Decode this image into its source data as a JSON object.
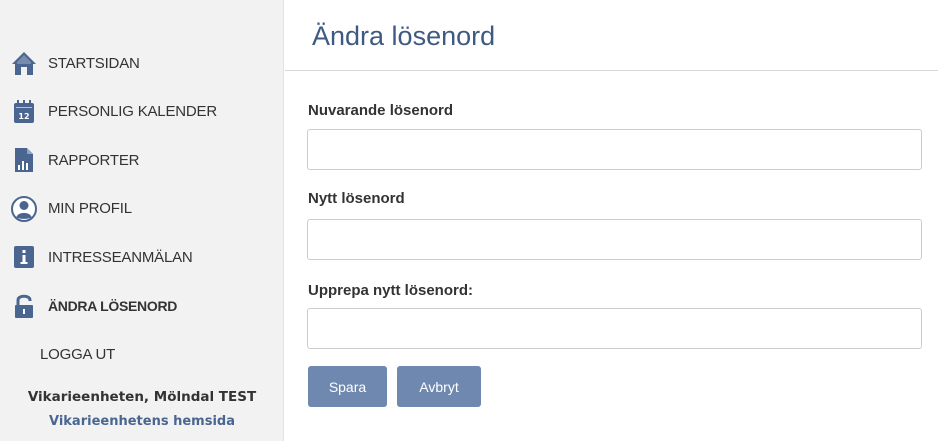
{
  "sidebar": {
    "items": [
      {
        "label": "STARTSIDAN",
        "icon": "home-icon"
      },
      {
        "label": "PERSONLIG KALENDER",
        "icon": "calendar-icon"
      },
      {
        "label": "RAPPORTER",
        "icon": "report-icon"
      },
      {
        "label": "MIN PROFIL",
        "icon": "profile-icon"
      },
      {
        "label": "INTRESSEANMÄLAN",
        "icon": "interest-icon"
      },
      {
        "label": "ÄNDRA LÖSENORD",
        "icon": "lock-icon",
        "active": true
      },
      {
        "label": "LOGGA UT"
      }
    ],
    "org_name": "Vikarieenheten, Mölndal TEST",
    "org_link": "Vikarieenhetens hemsida"
  },
  "main": {
    "title": "Ändra lösenord",
    "fields": [
      {
        "label": "Nuvarande lösenord",
        "value": ""
      },
      {
        "label": "Nytt lösenord",
        "value": ""
      },
      {
        "label": "Upprepa nytt lösenord:",
        "value": ""
      }
    ],
    "save_label": "Spara",
    "cancel_label": "Avbryt"
  },
  "colors": {
    "accent": "#3e5a82",
    "icon": "#4a6690",
    "button": "#6f88b0",
    "sidebar_bg": "#f2f2f2"
  }
}
